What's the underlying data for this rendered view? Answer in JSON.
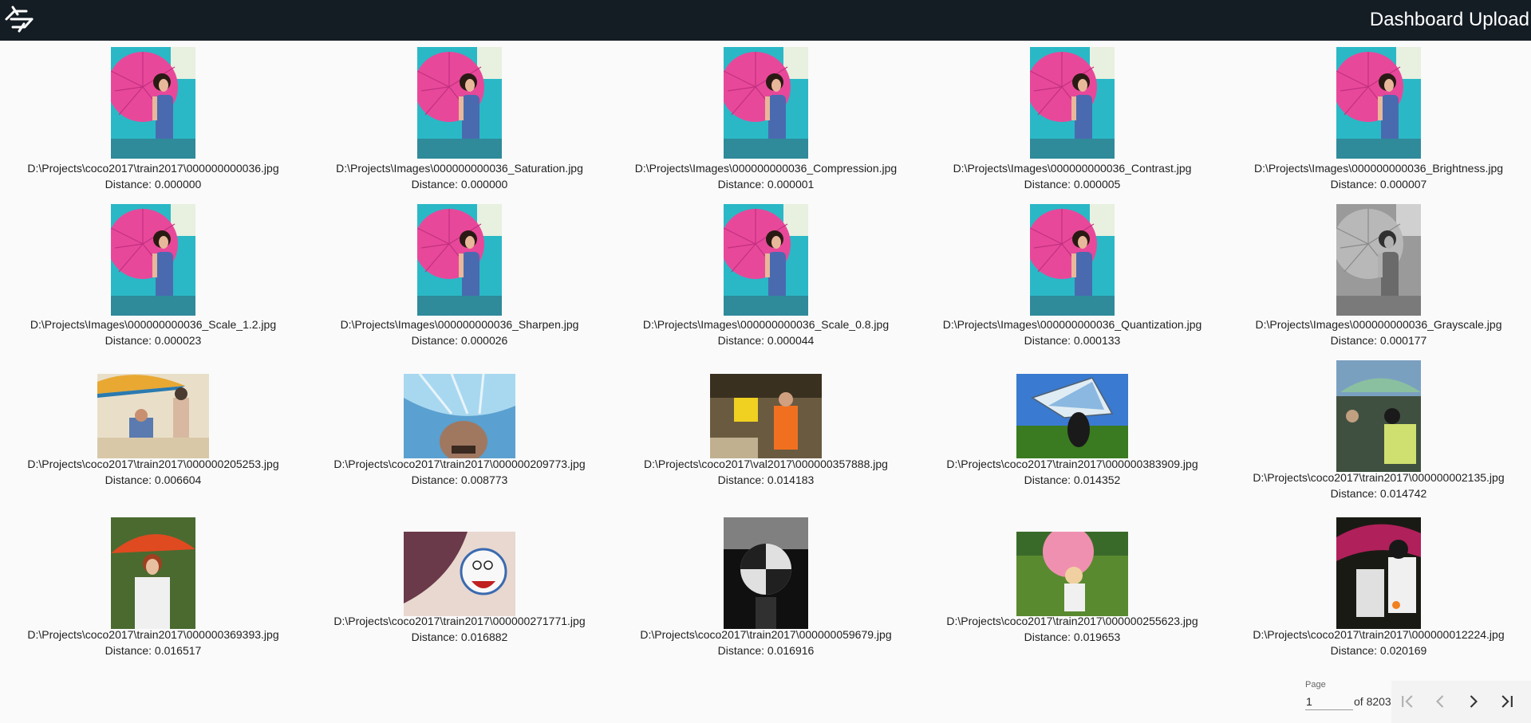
{
  "header": {
    "title": "Dashboard Upload",
    "logo_icon": "logo-icon",
    "background": "#141c24"
  },
  "results": [
    {
      "path": "D:\\Projects\\coco2017\\train2017\\000000000036.jpg",
      "distance": "Distance: 0.000000",
      "image": "umbrella-pink"
    },
    {
      "path": "D:\\Projects\\Images\\000000000036_Saturation.jpg",
      "distance": "Distance: 0.000000",
      "image": "umbrella-pink"
    },
    {
      "path": "D:\\Projects\\Images\\000000000036_Compression.jpg",
      "distance": "Distance: 0.000001",
      "image": "umbrella-pink"
    },
    {
      "path": "D:\\Projects\\Images\\000000000036_Contrast.jpg",
      "distance": "Distance: 0.000005",
      "image": "umbrella-pink"
    },
    {
      "path": "D:\\Projects\\Images\\000000000036_Brightness.jpg",
      "distance": "Distance: 0.000007",
      "image": "umbrella-pink"
    },
    {
      "path": "D:\\Projects\\Images\\000000000036_Scale_1.2.jpg",
      "distance": "Distance: 0.000023",
      "image": "umbrella-pink"
    },
    {
      "path": "D:\\Projects\\Images\\000000000036_Sharpen.jpg",
      "distance": "Distance: 0.000026",
      "image": "umbrella-pink"
    },
    {
      "path": "D:\\Projects\\Images\\000000000036_Scale_0.8.jpg",
      "distance": "Distance: 0.000044",
      "image": "umbrella-pink"
    },
    {
      "path": "D:\\Projects\\Images\\000000000036_Quantization.jpg",
      "distance": "Distance: 0.000133",
      "image": "umbrella-pink"
    },
    {
      "path": "D:\\Projects\\Images\\000000000036_Grayscale.jpg",
      "distance": "Distance: 0.000177",
      "image": "umbrella-gray"
    },
    {
      "path": "D:\\Projects\\coco2017\\train2017\\000000205253.jpg",
      "distance": "Distance: 0.006604",
      "image": "beach-umbrella"
    },
    {
      "path": "D:\\Projects\\coco2017\\train2017\\000000209773.jpg",
      "distance": "Distance: 0.008773",
      "image": "blue-umbrella-selfie"
    },
    {
      "path": "D:\\Projects\\coco2017\\val2017\\000000357888.jpg",
      "distance": "Distance: 0.014183",
      "image": "orange-shirt-kitchen"
    },
    {
      "path": "D:\\Projects\\coco2017\\train2017\\000000383909.jpg",
      "distance": "Distance: 0.014352",
      "image": "kite-field"
    },
    {
      "path": "D:\\Projects\\coco2017\\train2017\\000000002135.jpg",
      "distance": "Distance: 0.014742",
      "image": "green-umbrella-crowd"
    },
    {
      "path": "D:\\Projects\\coco2017\\train2017\\000000369393.jpg",
      "distance": "Distance: 0.016517",
      "image": "red-umbrella-woman"
    },
    {
      "path": "D:\\Projects\\coco2017\\train2017\\000000271771.jpg",
      "distance": "Distance: 0.016882",
      "image": "doraemon-umbrella"
    },
    {
      "path": "D:\\Projects\\coco2017\\train2017\\000000059679.jpg",
      "distance": "Distance: 0.016916",
      "image": "bw-umbrella"
    },
    {
      "path": "D:\\Projects\\coco2017\\train2017\\000000255623.jpg",
      "distance": "Distance: 0.019653",
      "image": "girl-pink-umbrella"
    },
    {
      "path": "D:\\Projects\\coco2017\\train2017\\000000012224.jpg",
      "distance": "Distance: 0.020169",
      "image": "night-umbrella"
    }
  ],
  "pager": {
    "label": "Page",
    "value": "1",
    "of_text": "of 8203",
    "first_icon": "first-page-icon",
    "prev_icon": "chevron-left-icon",
    "next_icon": "chevron-right-icon",
    "last_icon": "last-page-icon"
  }
}
